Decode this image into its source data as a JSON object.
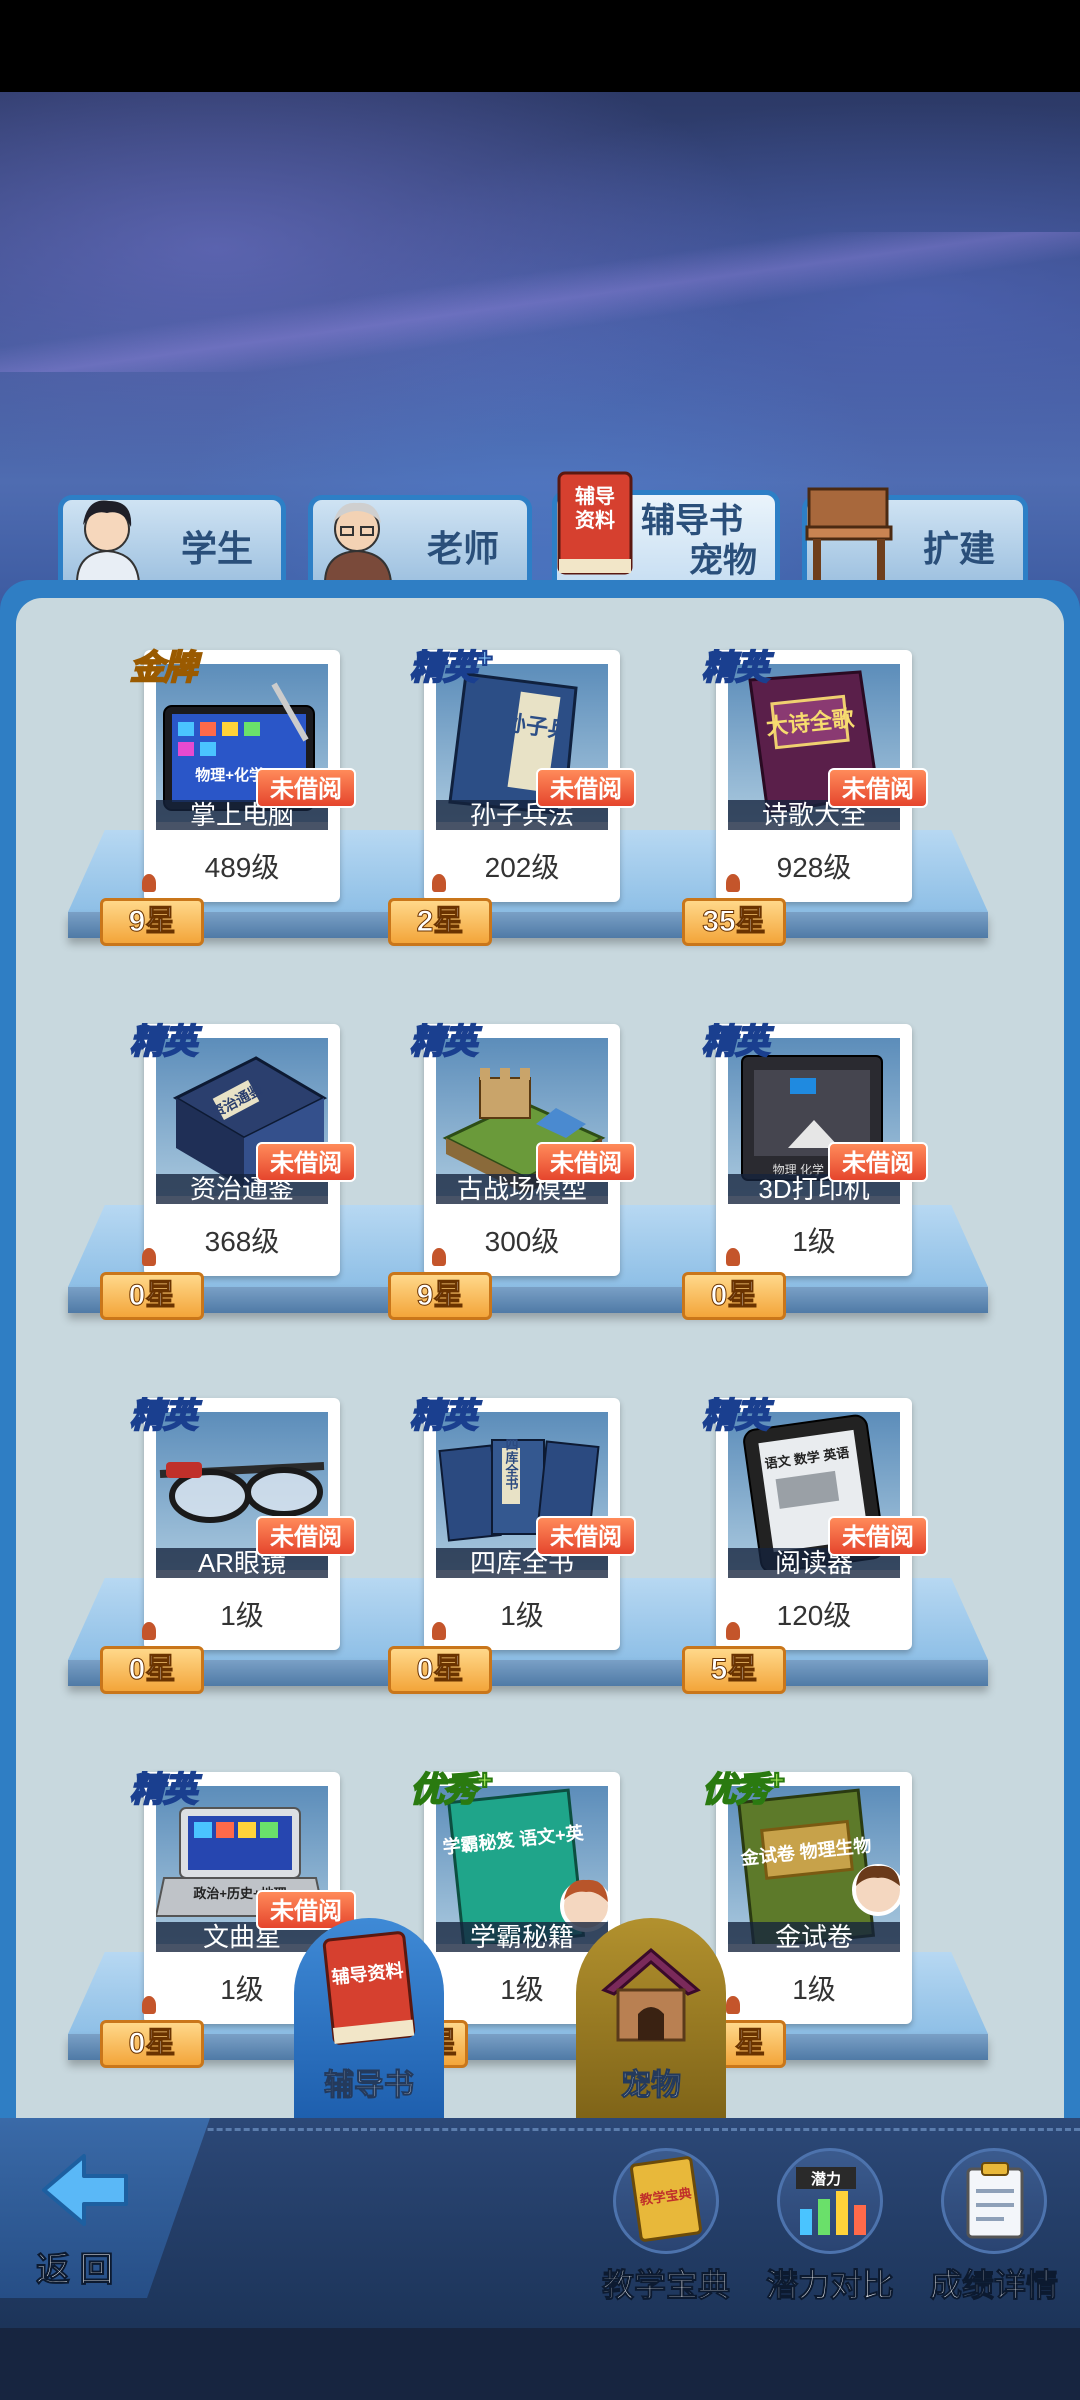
{
  "tabs": [
    {
      "label": "学生",
      "active": false
    },
    {
      "label": "老师",
      "active": false
    },
    {
      "label": "辅导书\n宠物",
      "label_line1": "辅导书",
      "label_line2": "宠物",
      "active": true
    },
    {
      "label": "扩建",
      "active": false
    }
  ],
  "tab_icon_text": "辅导\n资料",
  "tab_icon_line1": "辅导",
  "tab_icon_line2": "资料",
  "unread_label": "未借阅",
  "items": [
    {
      "tier": "金牌",
      "tier_plus": "",
      "name": "掌上电脑",
      "level": "489级",
      "stars": "9星",
      "unread": true,
      "icon": "tablet-icon",
      "img_text": "物理+化学+"
    },
    {
      "tier": "精英",
      "tier_plus": "+",
      "name": "孙子兵法",
      "level": "202级",
      "stars": "2星",
      "unread": true,
      "icon": "book-icon",
      "img_text": "孙子兵"
    },
    {
      "tier": "精英",
      "tier_plus": "",
      "name": "诗歌大全",
      "level": "928级",
      "stars": "35星",
      "unread": true,
      "icon": "book-icon",
      "img_text": "大诗全歌"
    },
    {
      "tier": "精英",
      "tier_plus": "",
      "name": "资治通鉴",
      "level": "368级",
      "stars": "0星",
      "unread": true,
      "icon": "book-stack-icon",
      "img_text": "资治通鉴"
    },
    {
      "tier": "精英",
      "tier_plus": "",
      "name": "古战场模型",
      "level": "300级",
      "stars": "9星",
      "unread": true,
      "icon": "castle-model-icon",
      "img_text": ""
    },
    {
      "tier": "精英",
      "tier_plus": "",
      "name": "3D打印机",
      "level": "1级",
      "stars": "0星",
      "unread": true,
      "icon": "printer-icon",
      "img_text": "物理 化学 生物"
    },
    {
      "tier": "精英",
      "tier_plus": "",
      "name": "AR眼镜",
      "level": "1级",
      "stars": "0星",
      "unread": true,
      "icon": "glasses-icon",
      "img_text": ""
    },
    {
      "tier": "精英",
      "tier_plus": "",
      "name": "四库全书",
      "level": "1级",
      "stars": "0星",
      "unread": true,
      "icon": "book-stack-icon",
      "img_text": "四库全书"
    },
    {
      "tier": "精英",
      "tier_plus": "",
      "name": "阅读器",
      "level": "120级",
      "stars": "5星",
      "unread": true,
      "icon": "ereader-icon",
      "img_text": "语文 数学 英语"
    },
    {
      "tier": "精英",
      "tier_plus": "",
      "name": "文曲星",
      "level": "1级",
      "stars": "0星",
      "unread": true,
      "icon": "laptop-icon",
      "img_text": "政治+历史+地理"
    },
    {
      "tier": "优秀",
      "tier_plus": "+",
      "name": "学霸秘籍",
      "level": "1级",
      "stars": "",
      "unread": false,
      "icon": "book-icon",
      "img_text": "学霸秘笈 语文+英"
    },
    {
      "tier": "优秀",
      "tier_plus": "+",
      "name": "金试卷",
      "level": "1级",
      "stars": "",
      "unread": false,
      "icon": "book-icon",
      "img_text": "金试卷 物理生物"
    }
  ],
  "partial_star_fragments": [
    "星",
    "星"
  ],
  "category_buttons": [
    {
      "label": "辅导书",
      "icon": "book-icon",
      "icon_text": "辅导资料"
    },
    {
      "label": "宠物",
      "icon": "doghouse-icon"
    }
  ],
  "bottom": {
    "back_label": "返 回",
    "tools": [
      {
        "label": "教学宝典",
        "icon": "book-icon",
        "icon_text": "教学宝典"
      },
      {
        "label": "潜力对比",
        "icon": "bar-chart-icon",
        "icon_text": "潜力"
      },
      {
        "label": "成绩详情",
        "icon": "clipboard-icon"
      }
    ]
  },
  "colors": {
    "panel_blue": "#2f7ec4",
    "unread_badge": "#e5452d",
    "star_badge": "#f3a53a",
    "tier_elite": "#8fd0ff",
    "tier_gold": "#ffd13a",
    "tier_excellent": "#aef25a"
  }
}
